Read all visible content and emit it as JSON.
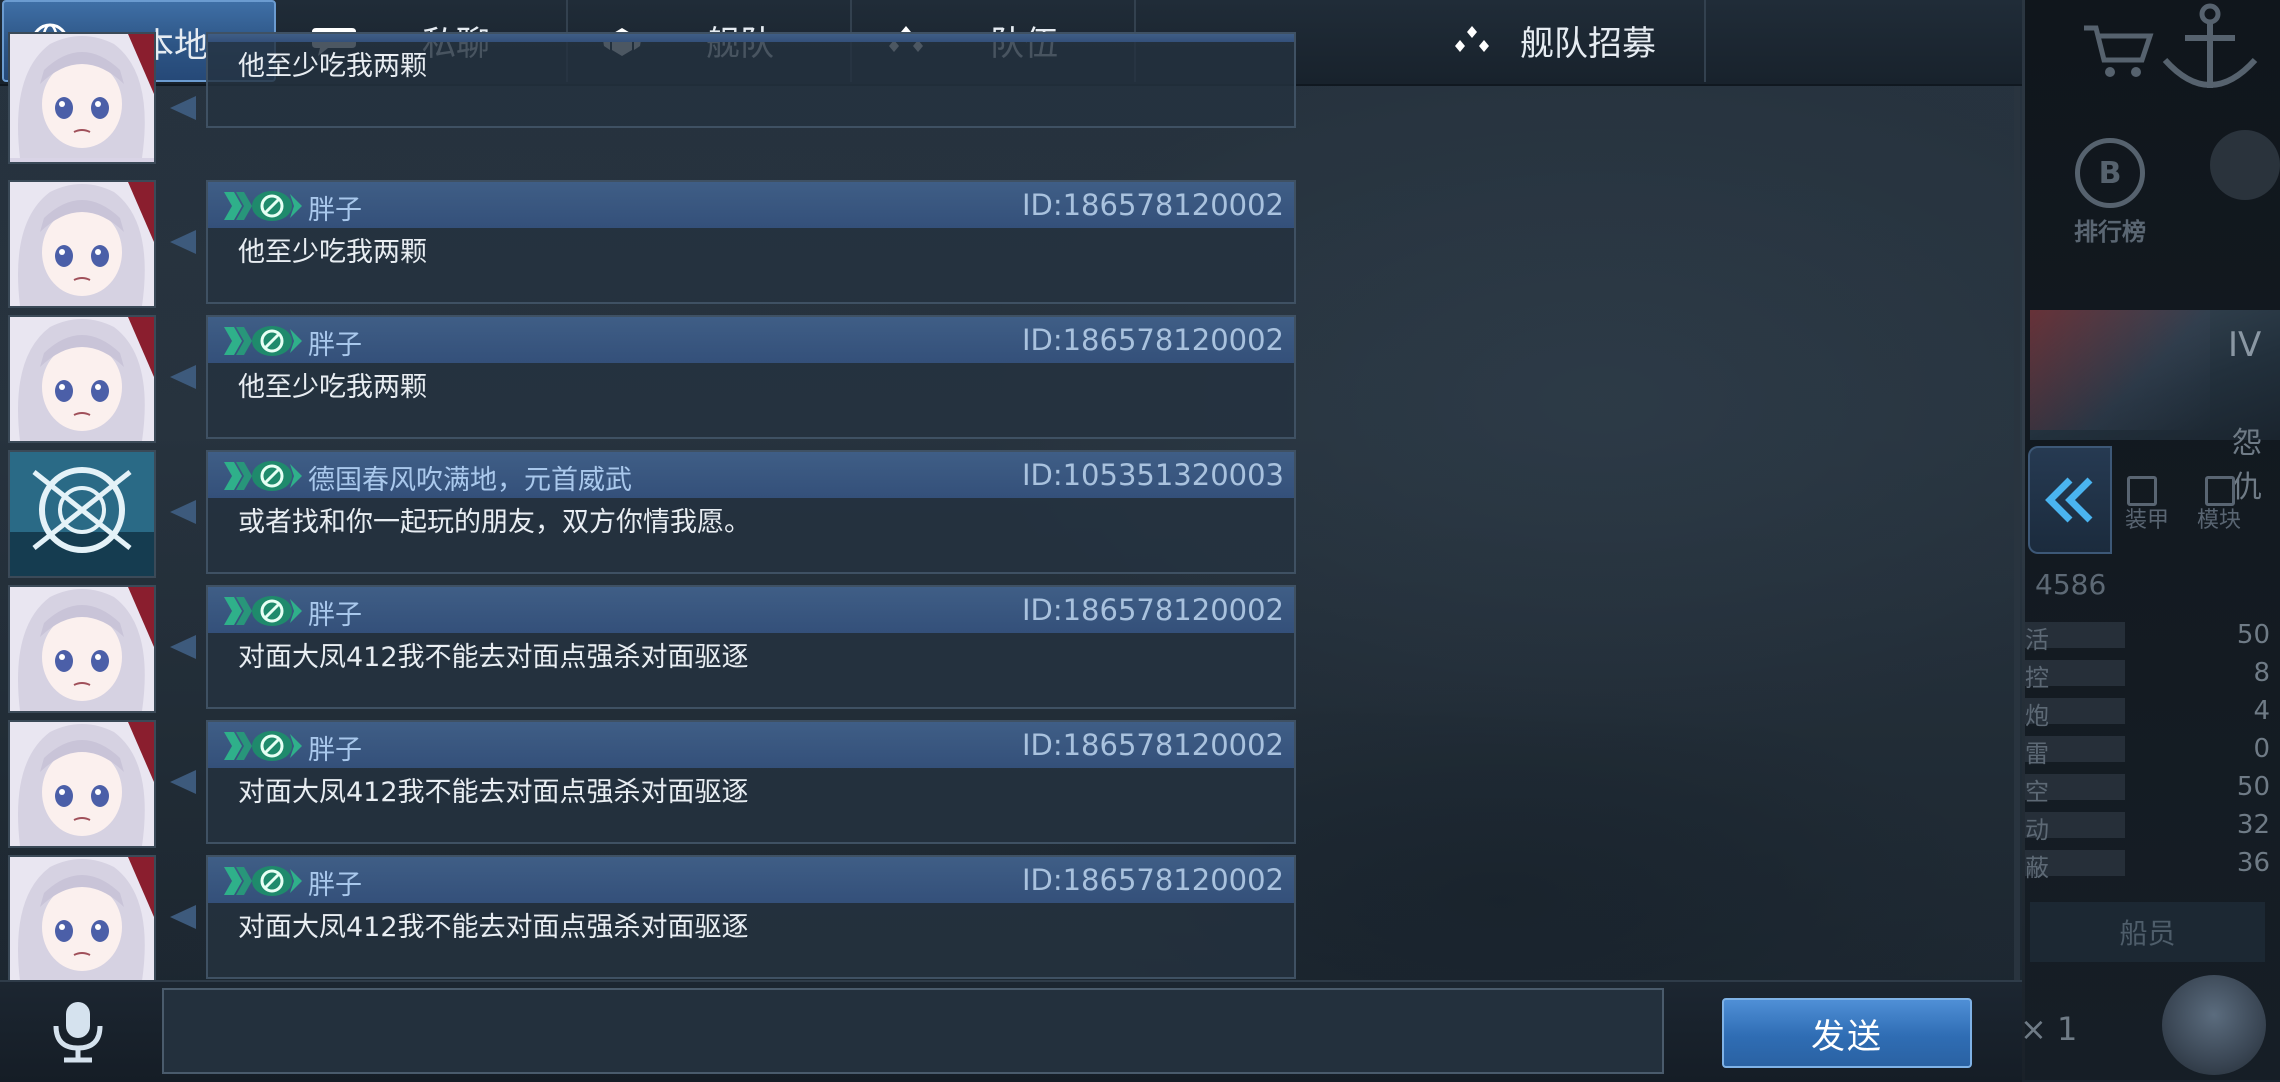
{
  "tabs": [
    {
      "label": "本地",
      "icon": "globe-icon",
      "active": true
    },
    {
      "label": "私聊",
      "icon": "chat-bubble-icon",
      "active": false
    },
    {
      "label": "舰队",
      "icon": "fleet-banner-icon",
      "active": false
    },
    {
      "label": "队伍",
      "icon": "team-dots-icon",
      "active": false
    },
    {
      "label": "舰队招募",
      "icon": "team-dots-icon",
      "active": false
    }
  ],
  "messages": [
    {
      "avatar": "anime-girl-avatar",
      "name": "",
      "uid": "",
      "text": "他至少吃我两颗"
    },
    {
      "avatar": "anime-girl-avatar",
      "name": "胖子",
      "uid": "ID:186578120002",
      "text": "他至少吃我两颗"
    },
    {
      "avatar": "anime-girl-avatar",
      "name": "胖子",
      "uid": "ID:186578120002",
      "text": "他至少吃我两颗"
    },
    {
      "avatar": "crosshair-avatar",
      "name": "德国春风吹满地，元首威武",
      "uid": "ID:105351320003",
      "text": "或者找和你一起玩的朋友，双方你情我愿。"
    },
    {
      "avatar": "anime-girl-avatar",
      "name": "胖子",
      "uid": "ID:186578120002",
      "text": "对面大凤412我不能去对面点强杀对面驱逐"
    },
    {
      "avatar": "anime-girl-avatar",
      "name": "胖子",
      "uid": "ID:186578120002",
      "text": "对面大凤412我不能去对面点强杀对面驱逐"
    },
    {
      "avatar": "anime-girl-avatar",
      "name": "胖子",
      "uid": "ID:186578120002",
      "text": "对面大凤412我不能去对面点强杀对面驱逐"
    }
  ],
  "input": {
    "value": "",
    "placeholder": ""
  },
  "send_label": "发送",
  "background": {
    "rank_label": "排行榜",
    "tier": "IV",
    "ship_name": "怨仇",
    "module_a": "装甲",
    "module_b": "模块",
    "score": "4586",
    "stats": [
      {
        "k": "活",
        "v": "50"
      },
      {
        "k": "控",
        "v": "8"
      },
      {
        "k": "炮",
        "v": "4"
      },
      {
        "k": "雷",
        "v": "0"
      },
      {
        "k": "空",
        "v": "50"
      },
      {
        "k": "动",
        "v": "32"
      },
      {
        "k": "蔽",
        "v": "36"
      }
    ],
    "crew_label": "船员",
    "multiplier": "× 1"
  },
  "colors": {
    "tab_active": "#3f6fa6",
    "bubble_header": "#3f5e86",
    "name_text": "#a9c8ec",
    "send_button": "#2f6db4",
    "badge_green": "#2fb08a"
  }
}
